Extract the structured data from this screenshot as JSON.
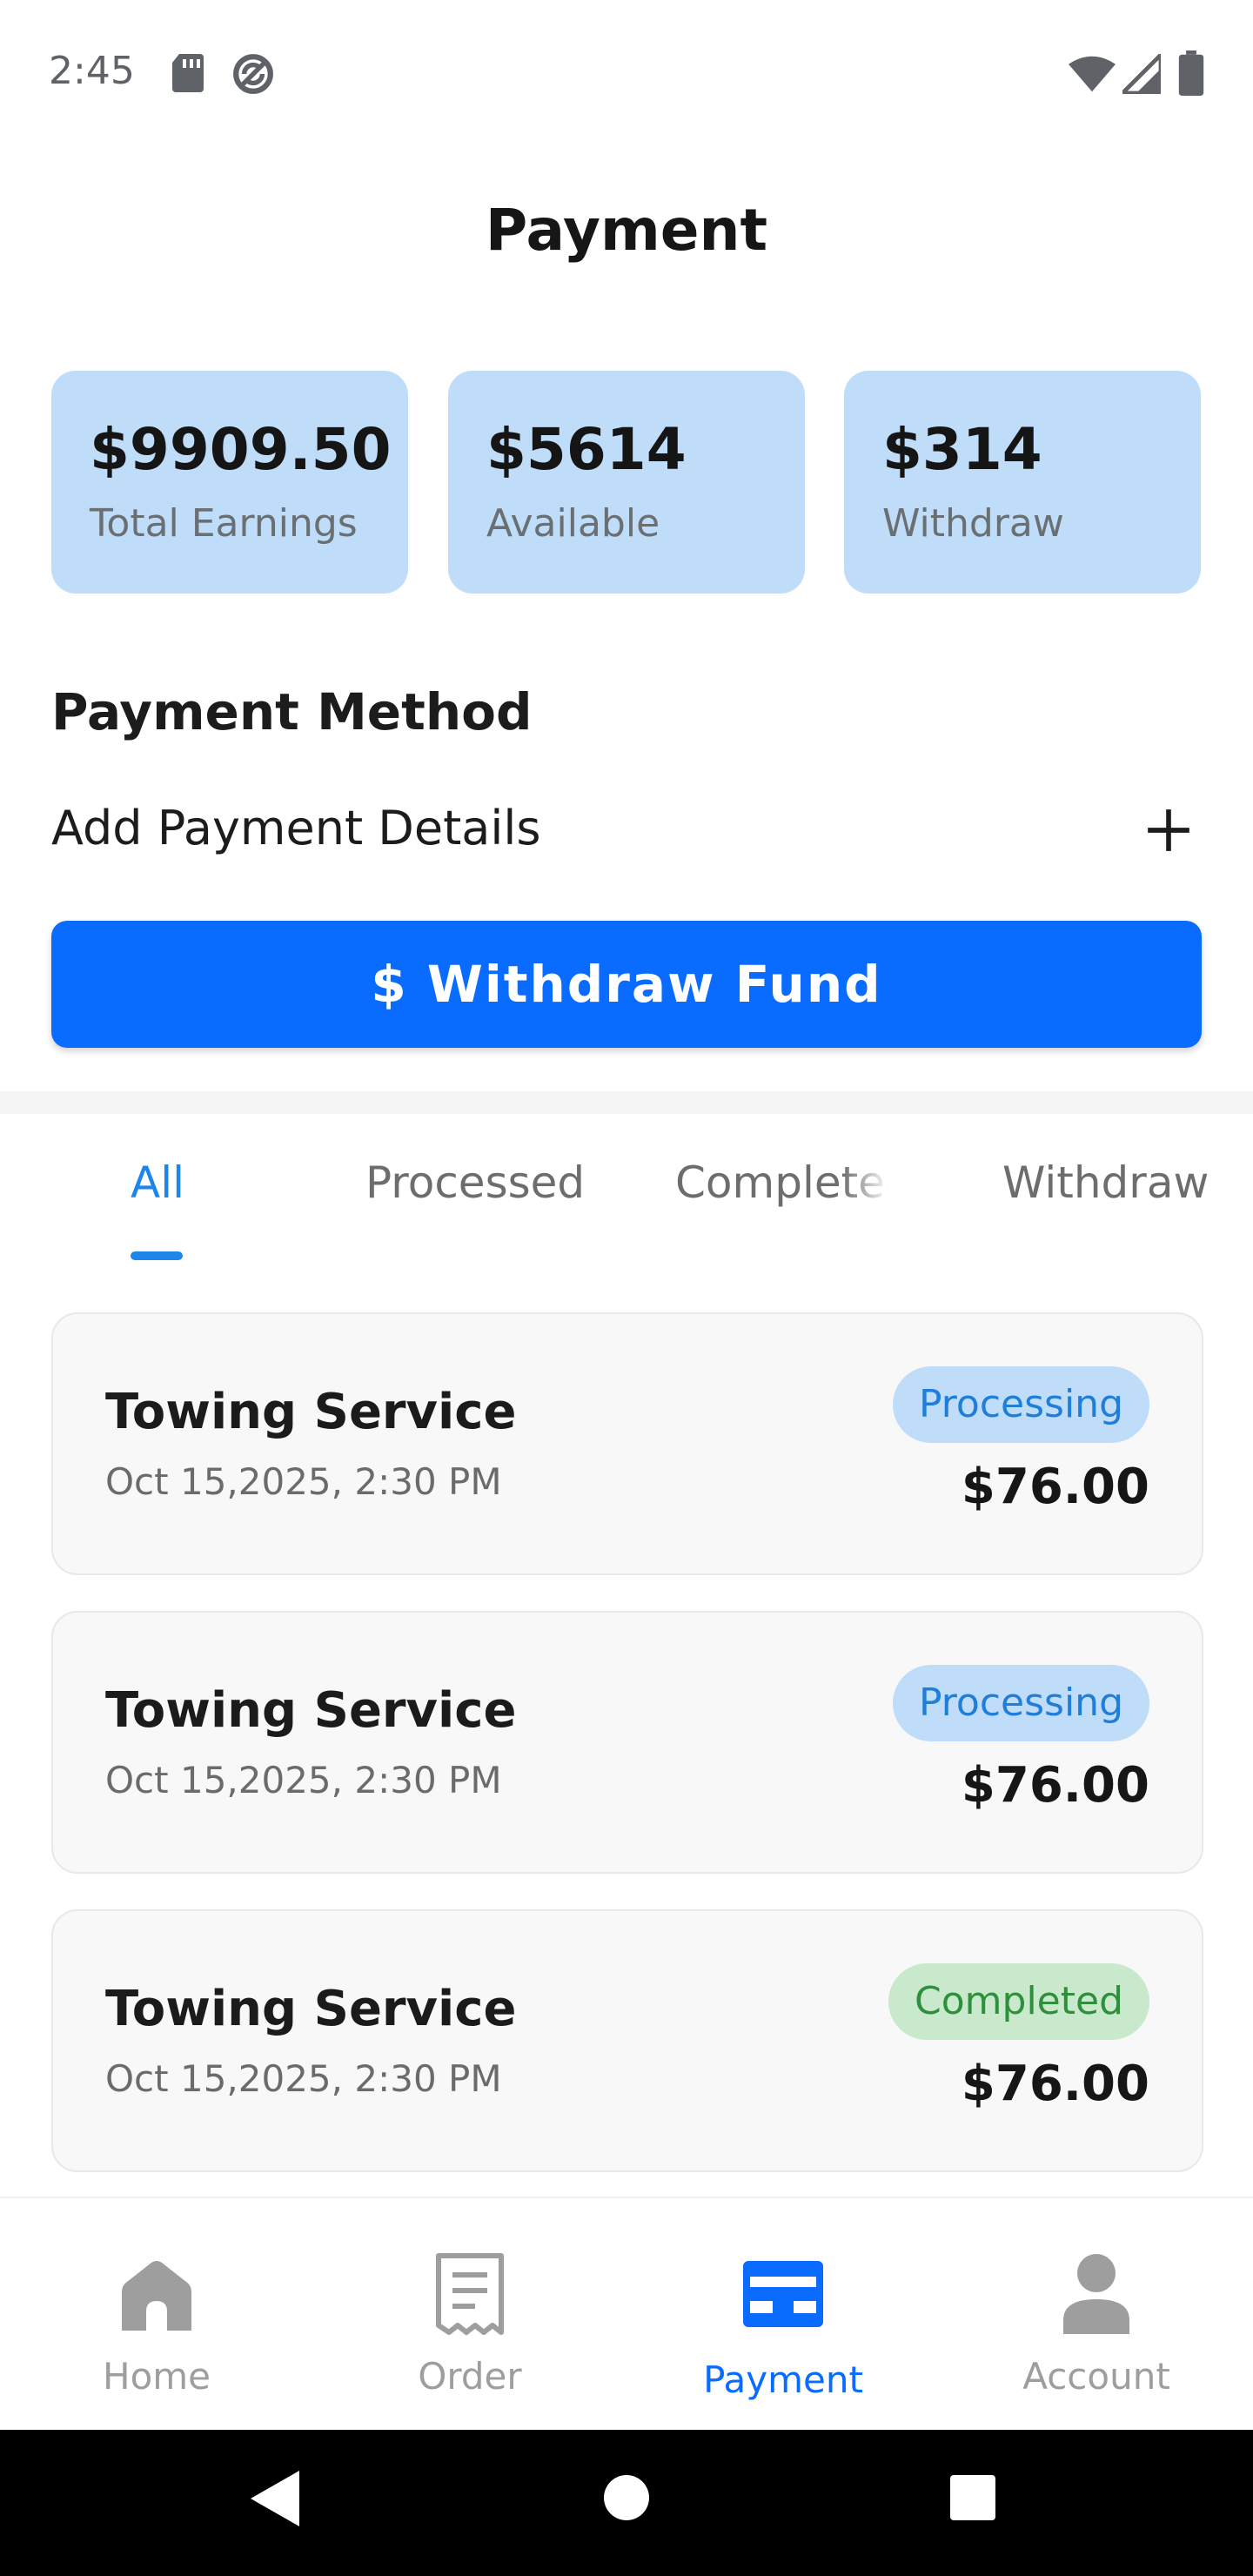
{
  "status_bar": {
    "time": "2:45",
    "icons": [
      "sd-card-icon",
      "sync-icon",
      "wifi-icon",
      "signal-icon",
      "battery-icon"
    ]
  },
  "header": {
    "title": "Payment"
  },
  "stats": [
    {
      "value": "$9909.50",
      "label": "Total Earnings"
    },
    {
      "value": "$5614",
      "label": "Available"
    },
    {
      "value": "$314",
      "label": "Withdraw"
    }
  ],
  "payment_method": {
    "title": "Payment Method",
    "add_label": "Add Payment Details",
    "add_icon": "plus-icon"
  },
  "withdraw_button": {
    "label": "$ Withdraw Fund"
  },
  "tabs": [
    {
      "label": "All",
      "active": true
    },
    {
      "label": "Processed",
      "active": false
    },
    {
      "label": "Completed",
      "active": false
    },
    {
      "label": "Withdraw",
      "active": false
    }
  ],
  "transactions": [
    {
      "title": "Towing Service",
      "date": "Oct 15,2025, 2:30 PM",
      "status": "Processing",
      "amount": "$76.00"
    },
    {
      "title": "Towing Service",
      "date": "Oct 15,2025, 2:30 PM",
      "status": "Processing",
      "amount": "$76.00"
    },
    {
      "title": "Towing Service",
      "date": "Oct 15,2025, 2:30 PM",
      "status": "Completed",
      "amount": "$76.00"
    }
  ],
  "bottom_nav": [
    {
      "label": "Home",
      "icon": "home-icon",
      "active": false
    },
    {
      "label": "Order",
      "icon": "receipt-icon",
      "active": false
    },
    {
      "label": "Payment",
      "icon": "payment-card-icon",
      "active": true
    },
    {
      "label": "Account",
      "icon": "person-icon",
      "active": false
    }
  ],
  "colors": {
    "accent": "#0a6cff",
    "tab_active": "#1d86e8",
    "card_blue": "#bfdcf8",
    "badge_processing_text": "#1f7ed9",
    "badge_completed_bg": "#c8e9cc",
    "badge_completed_text": "#2f8f3c"
  }
}
